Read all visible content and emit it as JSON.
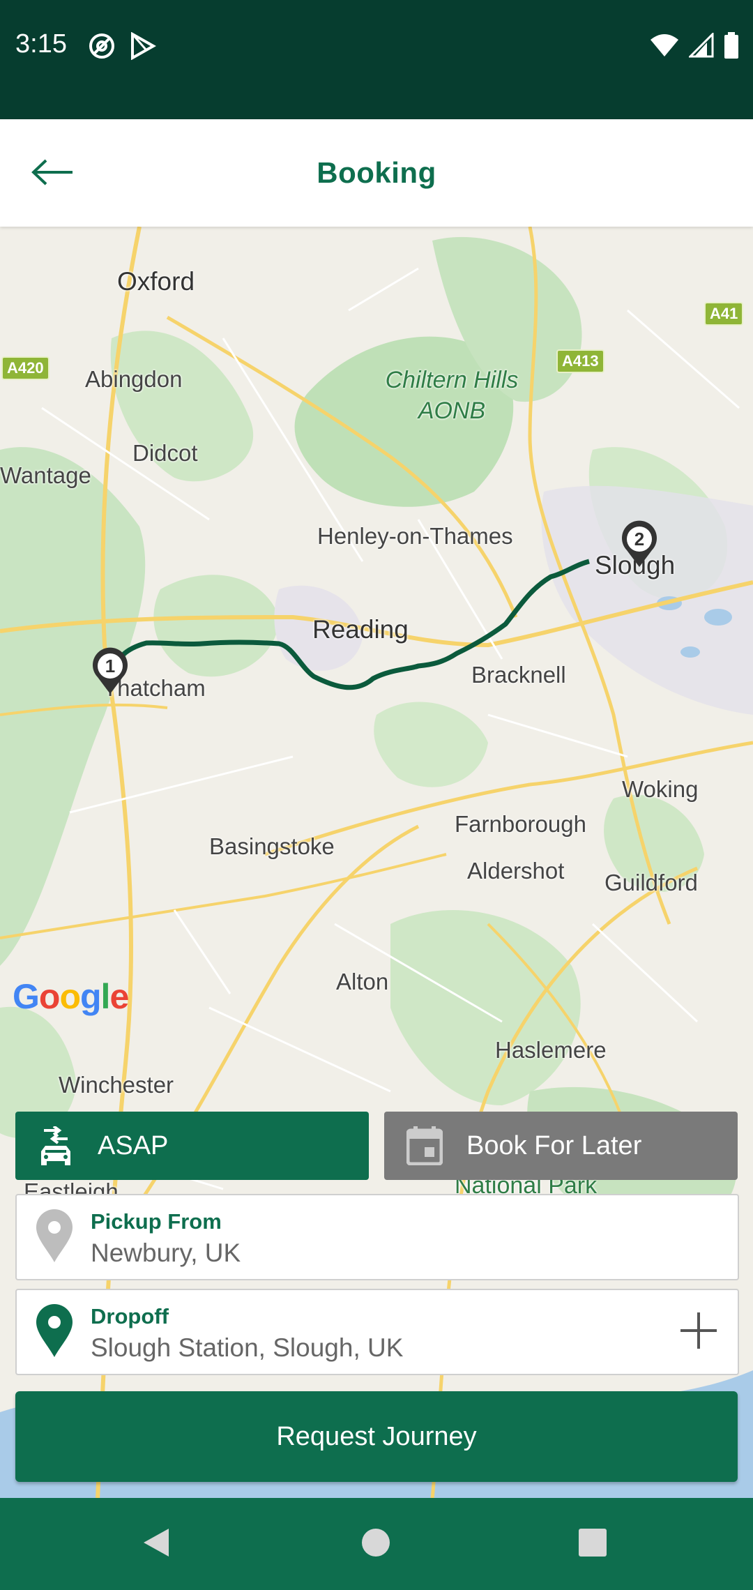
{
  "status_bar": {
    "time": "3:15",
    "left_icons": [
      "at-sign-icon",
      "play-store-icon"
    ],
    "right_icons": [
      "wifi-icon",
      "cell-signal-icon",
      "battery-icon"
    ]
  },
  "app_bar": {
    "title": "Booking",
    "back_icon": "arrow-left-icon"
  },
  "map": {
    "place_labels": {
      "oxford": "Oxford",
      "abingdon": "Abingdon",
      "didcot": "Didcot",
      "wantage": "Wantage",
      "chiltern": "Chiltern Hills AONB",
      "henley": "Henley-on-Thames",
      "slough": "Slough",
      "reading": "Reading",
      "bracknell": "Bracknell",
      "thatcham": "Thatcham",
      "woking": "Woking",
      "farnborough": "Farnborough",
      "basingstoke": "Basingstoke",
      "aldershot": "Aldershot",
      "guildford": "Guildford",
      "alton": "Alton",
      "haslemere": "Haslemere",
      "winchester": "Winchester",
      "eastleigh": "Eastleigh",
      "national_park": "National Park"
    },
    "road_shields": {
      "a420": "A420",
      "a413": "A413",
      "a41": "A41"
    },
    "attribution": "Google",
    "markers": [
      "1",
      "2"
    ],
    "route_color": "#0b5a3c"
  },
  "modes": {
    "asap": {
      "label": "ASAP",
      "icon": "car-swap-icon",
      "selected": true
    },
    "later": {
      "label": "Book For Later",
      "icon": "calendar-icon",
      "selected": false
    }
  },
  "pickup": {
    "label": "Pickup From",
    "value": "Newbury, UK",
    "icon": "location-pin-icon"
  },
  "dropoff": {
    "label": "Dropoff",
    "value": "Slough Station, Slough, UK",
    "icon": "location-pin-icon",
    "add_icon": "plus-icon"
  },
  "request_button": {
    "label": "Request Journey"
  },
  "nav_bar": [
    "back-triangle-icon",
    "home-circle-icon",
    "recents-square-icon"
  ],
  "colors": {
    "primary": "#0e6e4e",
    "status_bar": "#063d2f",
    "disabled": "#7a7a7a"
  }
}
